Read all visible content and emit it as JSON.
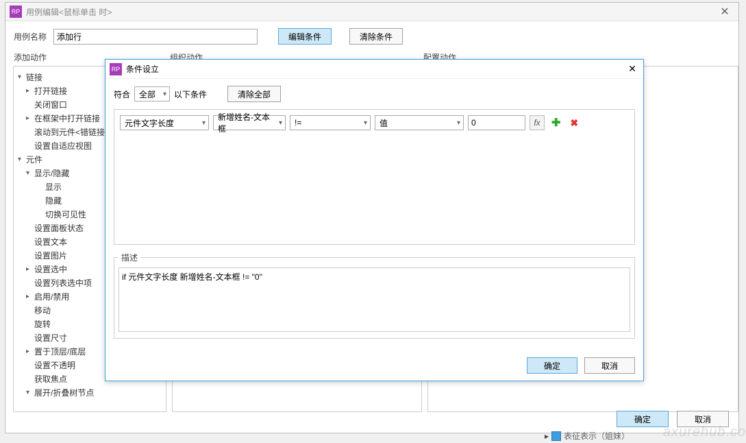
{
  "main": {
    "title": "用例编辑<鼠标单击 时>",
    "rp": "RP",
    "close": "✕",
    "nameLabel": "用例名称",
    "nameValue": "添加行",
    "editCond": "编辑条件",
    "clearCond": "清除条件",
    "sh1": "添加动作",
    "sh2": "组织动作",
    "sh3": "配置动作",
    "ok": "确定",
    "cancel": "取消"
  },
  "tree": [
    {
      "t": "链接",
      "a": "▾",
      "i": 0
    },
    {
      "t": "打开链接",
      "a": "▸",
      "i": 1
    },
    {
      "t": "关闭窗口",
      "a": "",
      "i": 1
    },
    {
      "t": "在框架中打开链接",
      "a": "▸",
      "i": 1
    },
    {
      "t": "滚动到元件<错链接",
      "a": "",
      "i": 1
    },
    {
      "t": "设置自适应视图",
      "a": "",
      "i": 1
    },
    {
      "t": "元件",
      "a": "▾",
      "i": 0
    },
    {
      "t": "显示/隐藏",
      "a": "▾",
      "i": 1
    },
    {
      "t": "显示",
      "a": "",
      "i": 2
    },
    {
      "t": "隐藏",
      "a": "",
      "i": 2
    },
    {
      "t": "切换可见性",
      "a": "",
      "i": 2
    },
    {
      "t": "设置面板状态",
      "a": "",
      "i": 1
    },
    {
      "t": "设置文本",
      "a": "",
      "i": 1
    },
    {
      "t": "设置图片",
      "a": "",
      "i": 1
    },
    {
      "t": "设置选中",
      "a": "▸",
      "i": 1
    },
    {
      "t": "设置列表选中项",
      "a": "",
      "i": 1
    },
    {
      "t": "启用/禁用",
      "a": "▸",
      "i": 1
    },
    {
      "t": "移动",
      "a": "",
      "i": 1
    },
    {
      "t": "旋转",
      "a": "",
      "i": 1
    },
    {
      "t": "设置尺寸",
      "a": "",
      "i": 1
    },
    {
      "t": "置于顶层/底层",
      "a": "▸",
      "i": 1
    },
    {
      "t": "设置不透明",
      "a": "",
      "i": 1
    },
    {
      "t": "获取焦点",
      "a": "",
      "i": 1
    },
    {
      "t": "展开/折叠树节点",
      "a": "▾",
      "i": 1
    }
  ],
  "modal": {
    "title": "条件设立",
    "rp": "RP",
    "close": "✕",
    "matchLabel": "符合",
    "matchValue": "全部",
    "matchSuffix": "以下条件",
    "clearAll": "清除全部",
    "row": {
      "c1": "元件文字长度",
      "c2": "新增姓名-文本框",
      "c3": "!=",
      "c4": "值",
      "val": "0",
      "fx": "fx",
      "plus": "✚",
      "del": "✖"
    },
    "descLegend": "描述",
    "descText": "if 元件文字长度 新增姓名-文本框 != \"0\"",
    "ok": "确定",
    "cancel": "取消"
  },
  "bgFrag": "表征表示（姐妹）"
}
